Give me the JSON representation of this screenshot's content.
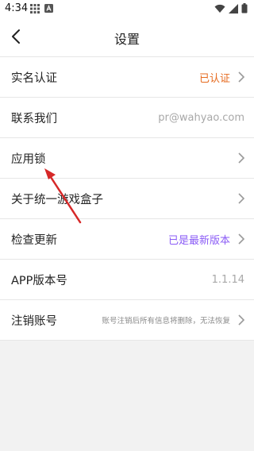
{
  "statusbar": {
    "time": "4:34",
    "icons": [
      "grid-icon",
      "a-badge-icon",
      "wifi-icon",
      "signal-icon",
      "battery-icon"
    ]
  },
  "header": {
    "title": "设置"
  },
  "settings": [
    {
      "label": "实名认证",
      "value": "已认证",
      "value_color": "#e66a1e",
      "arrow": true
    },
    {
      "label": "联系我们",
      "value": "pr@wahyao.com",
      "value_color": "#a8a8a8",
      "arrow": false
    },
    {
      "label": "应用锁",
      "value": "",
      "arrow": true
    },
    {
      "label": "关于统一游戏盒子",
      "value": "",
      "arrow": true
    },
    {
      "label": "检查更新",
      "value": "已是最新版本",
      "value_color": "#8b5cf6",
      "arrow": true
    },
    {
      "label": "APP版本号",
      "value": "1.1.14",
      "value_color": "#a8a8a8",
      "arrow": false
    },
    {
      "label": "注销账号",
      "value": "账号注销后所有信息将删除，无法恢复",
      "value_color": "#8a8a8a",
      "arrow": true
    }
  ],
  "colors": {
    "annotation_arrow": "#d62828"
  }
}
